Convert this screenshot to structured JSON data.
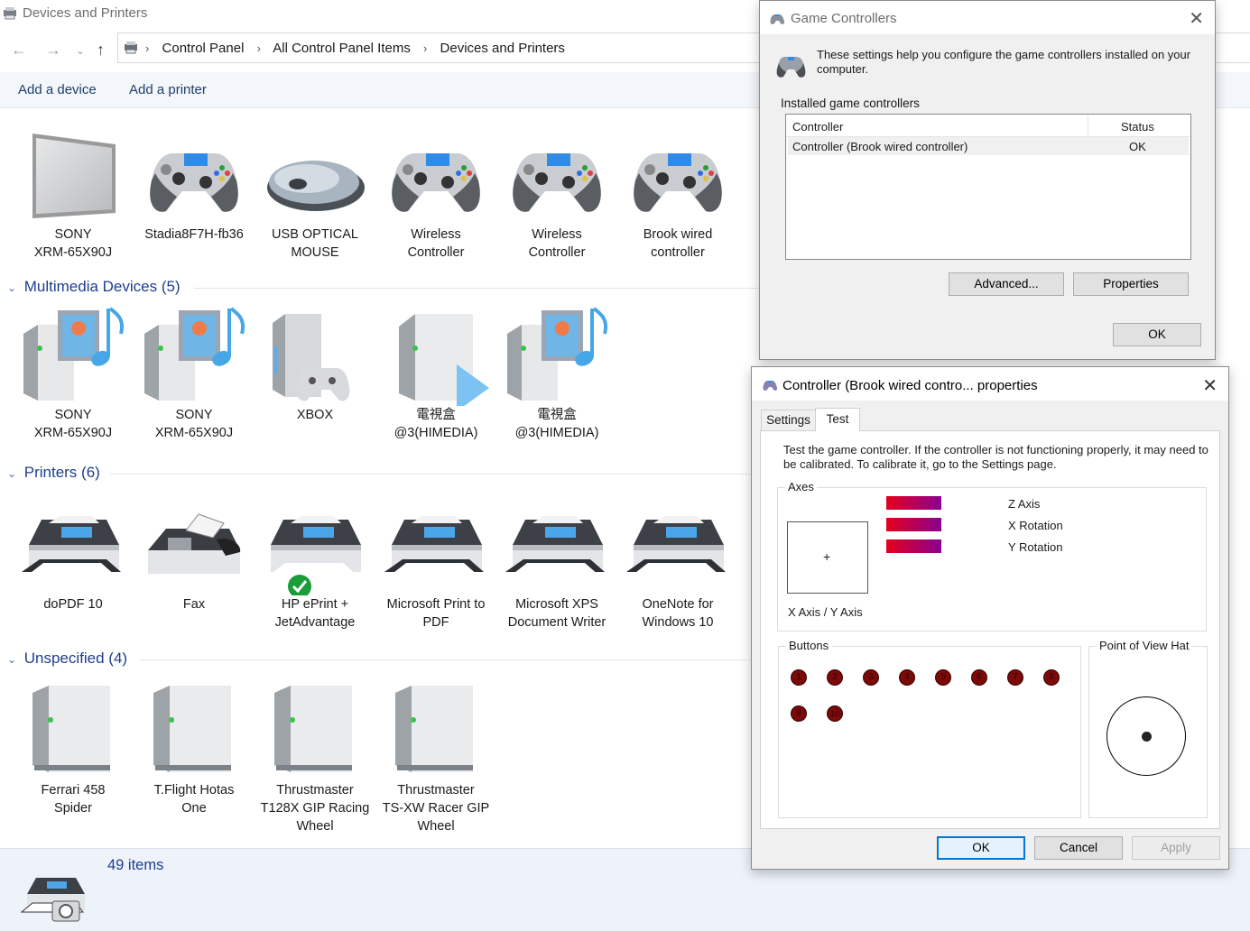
{
  "window": {
    "title": "Devices and Printers"
  },
  "breadcrumbs": [
    "Control Panel",
    "All Control Panel Items",
    "Devices and Printers"
  ],
  "commands": [
    "Add a device",
    "Add a printer"
  ],
  "devices_top": [
    {
      "line1": "SONY",
      "line2": "XRM-65X90J",
      "icon": "tv-icon"
    },
    {
      "line1": "Stadia8F7H-fb36",
      "line2": "",
      "icon": "gamepad-icon"
    },
    {
      "line1": "USB OPTICAL",
      "line2": "MOUSE",
      "icon": "mouse-icon"
    },
    {
      "line1": "Wireless",
      "line2": "Controller",
      "icon": "gamepad-icon"
    },
    {
      "line1": "Wireless",
      "line2": "Controller",
      "icon": "gamepad-icon"
    },
    {
      "line1": "Brook wired",
      "line2": "controller",
      "icon": "gamepad-icon"
    }
  ],
  "groups": {
    "multimedia": {
      "name": "Multimedia Devices",
      "count": "(5)"
    },
    "printers": {
      "name": "Printers",
      "count": "(6)"
    },
    "unspecified": {
      "name": "Unspecified",
      "count": "(4)"
    }
  },
  "multimedia": [
    {
      "line1": "SONY",
      "line2": "XRM-65X90J",
      "icon": "media-server-icon"
    },
    {
      "line1": "SONY",
      "line2": "XRM-65X90J",
      "icon": "media-server-icon"
    },
    {
      "line1": "XBOX",
      "line2": "",
      "icon": "xbox-icon"
    },
    {
      "line1": "電視盒",
      "line2": "@3(HIMEDIA)",
      "icon": "media-player-icon"
    },
    {
      "line1": "電視盒",
      "line2": "@3(HIMEDIA)",
      "icon": "media-server-icon"
    }
  ],
  "printers": [
    {
      "line1": "doPDF 10",
      "line2": "",
      "icon": "printer-icon"
    },
    {
      "line1": "Fax",
      "line2": "",
      "icon": "fax-icon"
    },
    {
      "line1": "HP ePrint +",
      "line2": "JetAdvantage",
      "icon": "printer-default-icon"
    },
    {
      "line1": "Microsoft Print to",
      "line2": "PDF",
      "icon": "printer-icon"
    },
    {
      "line1": "Microsoft XPS",
      "line2": "Document Writer",
      "icon": "printer-icon"
    },
    {
      "line1": "OneNote for",
      "line2": "Windows 10",
      "icon": "printer-icon"
    }
  ],
  "unspecified": [
    {
      "line1": "Ferrari 458",
      "line2": "Spider",
      "line3": "",
      "icon": "generic-device-icon"
    },
    {
      "line1": "T.Flight Hotas",
      "line2": "One",
      "line3": "",
      "icon": "generic-device-icon"
    },
    {
      "line1": "Thrustmaster",
      "line2": "T128X GIP Racing",
      "line3": "Wheel",
      "icon": "generic-device-icon"
    },
    {
      "line1": "Thrustmaster",
      "line2": "TS-XW Racer GIP",
      "line3": "Wheel",
      "icon": "generic-device-icon"
    }
  ],
  "status": {
    "count": "49 items"
  },
  "game_controllers": {
    "title": "Game Controllers",
    "description": "These settings help you configure the game controllers installed on your computer.",
    "group_label": "Installed game controllers",
    "columns": [
      "Controller",
      "Status"
    ],
    "rows": [
      {
        "controller": "Controller (Brook wired controller)",
        "status": "OK"
      }
    ],
    "advanced": "Advanced...",
    "properties": "Properties",
    "ok": "OK"
  },
  "properties": {
    "title": "Controller (Brook wired contro... properties",
    "tabs": [
      "Settings",
      "Test"
    ],
    "active_tab": "Test",
    "description": "Test the game controller.  If the controller is not functioning properly, it may need to be calibrated.  To calibrate it, go to the Settings page.",
    "axes_label": "Axes",
    "xy_label": "X Axis / Y Axis",
    "axis_bars": [
      "Z Axis",
      "X Rotation",
      "Y Rotation"
    ],
    "buttons_label": "Buttons",
    "buttons": [
      "1",
      "2",
      "3",
      "4",
      "5",
      "6",
      "7",
      "8",
      "9",
      "10"
    ],
    "pov_label": "Point of View Hat",
    "ok": "OK",
    "cancel": "Cancel",
    "apply": "Apply"
  },
  "colors": {
    "accent": "#0078d7",
    "link": "#1e3d8f",
    "status_ok": "#1a9c3a",
    "axis_bar_start": "#e5001b",
    "axis_bar_end": "#8a0090"
  }
}
